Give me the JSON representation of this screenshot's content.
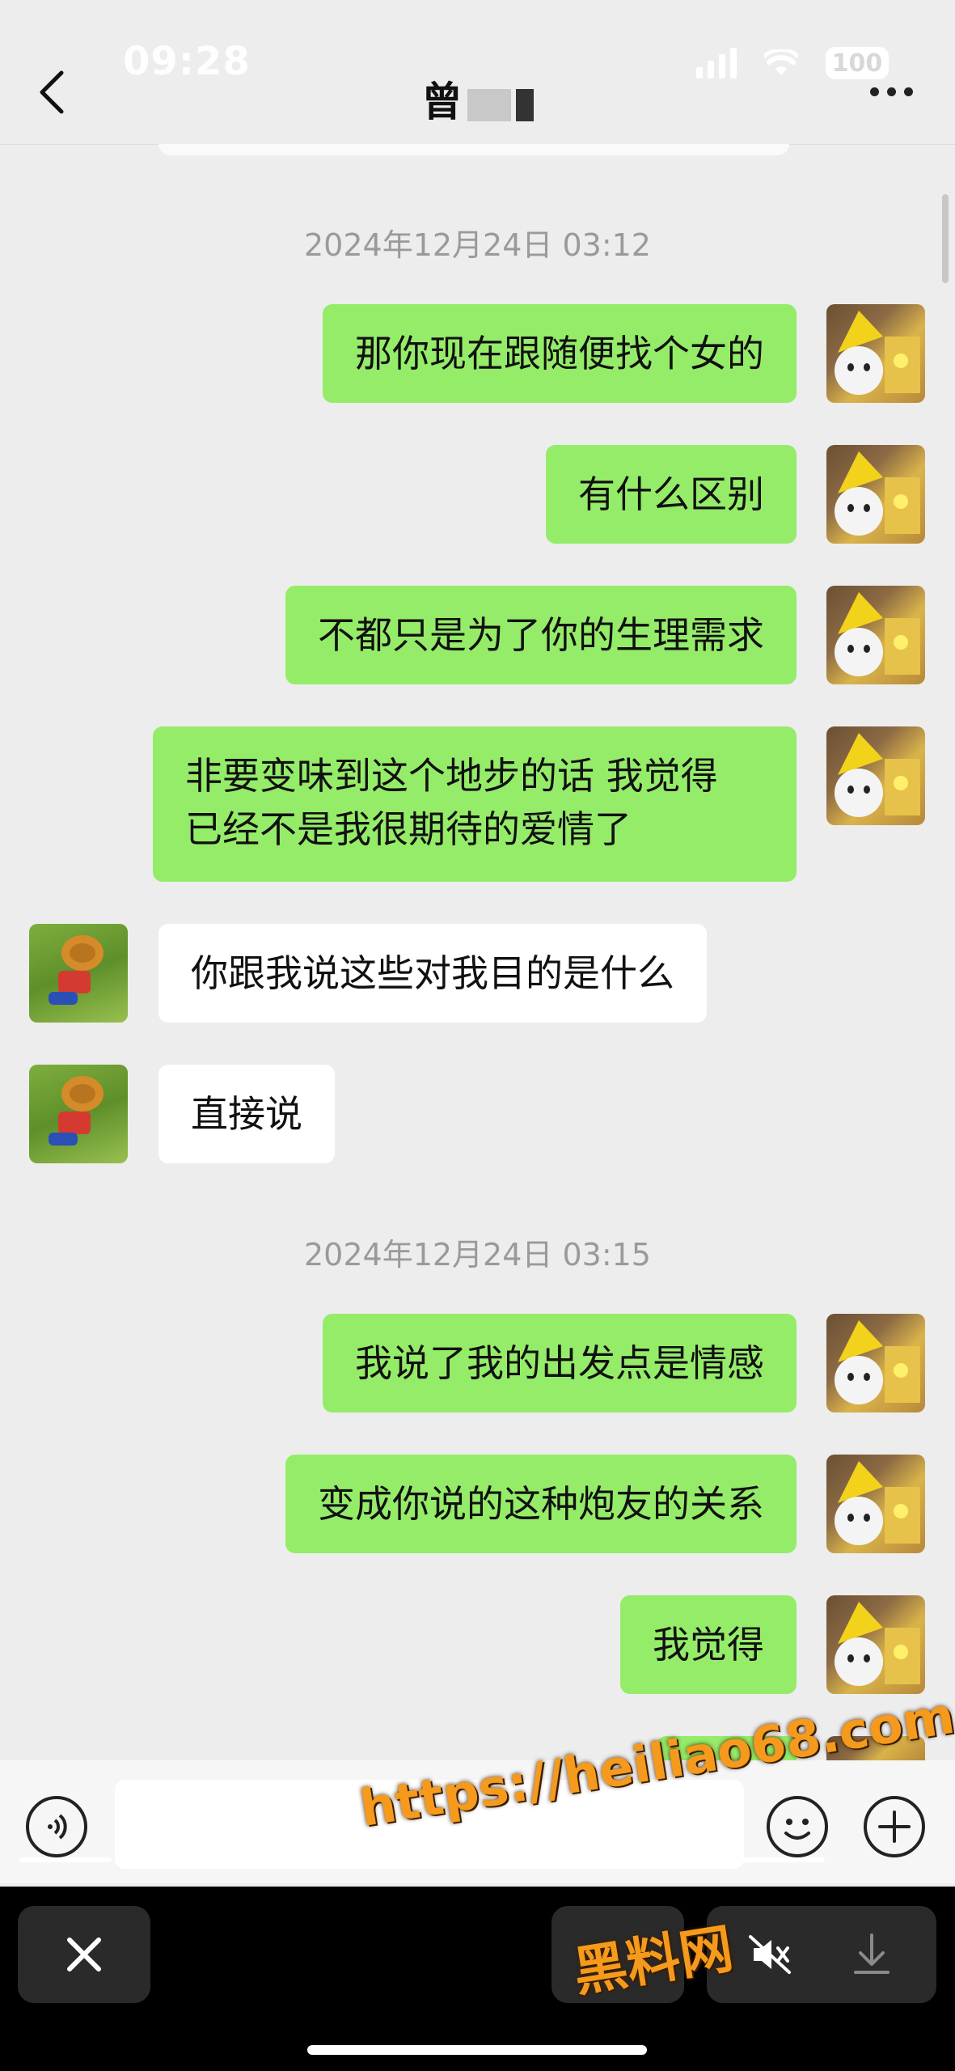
{
  "status_bar": {
    "time": "09:28",
    "battery": "100"
  },
  "header": {
    "title": "曾"
  },
  "messages": [
    {
      "type": "timestamp",
      "text": "2024年12月24日 03:12"
    },
    {
      "side": "out",
      "text": "那你现在跟随便找个女的"
    },
    {
      "side": "out",
      "text": "有什么区别"
    },
    {
      "side": "out",
      "text": "不都只是为了你的生理需求"
    },
    {
      "side": "out",
      "lines": [
        "非要变味到这个地步的话 我觉得",
        "已经不是我很期待的爱情了"
      ]
    },
    {
      "side": "in",
      "text": "你跟我说这些对我目的是什么"
    },
    {
      "side": "in",
      "text": "直接说"
    },
    {
      "type": "timestamp",
      "text": "2024年12月24日 03:15"
    },
    {
      "side": "out",
      "text": "我说了我的出发点是情感"
    },
    {
      "side": "out",
      "text": "变成你说的这种炮友的关系"
    },
    {
      "side": "out",
      "text": "我觉得"
    }
  ],
  "input": {
    "placeholder": ""
  },
  "watermark": {
    "url": "https://heiliao68.com",
    "name": "黑料网"
  },
  "colors": {
    "outgoing_bubble": "#95ec69",
    "incoming_bubble": "#ffffff",
    "background": "#ededed"
  },
  "icons": {
    "back": "chevron-left-icon",
    "more": "more-dots-icon",
    "voice": "voice-icon",
    "emoji": "emoji-icon",
    "plus": "plus-icon",
    "close": "close-icon",
    "mute": "mute-icon",
    "download": "download-icon"
  }
}
